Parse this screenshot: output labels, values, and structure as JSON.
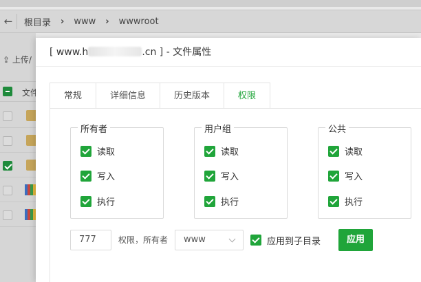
{
  "background": {
    "back_icon": "arrow-left-icon",
    "breadcrumbs": [
      "根目录",
      "www",
      "wwwroot"
    ],
    "upload_label": "上传/",
    "column_header": "文件"
  },
  "dialog": {
    "title_prefix": "[ www.h",
    "title_suffix": ".cn ] - 文件属性",
    "tabs": [
      {
        "label": "常规",
        "active": false
      },
      {
        "label": "详细信息",
        "active": false
      },
      {
        "label": "历史版本",
        "active": false
      },
      {
        "label": "权限",
        "active": true
      }
    ],
    "groups": [
      {
        "title": "所有者",
        "perms": [
          {
            "label": "读取",
            "checked": true
          },
          {
            "label": "写入",
            "checked": true
          },
          {
            "label": "执行",
            "checked": true
          }
        ]
      },
      {
        "title": "用户组",
        "perms": [
          {
            "label": "读取",
            "checked": true
          },
          {
            "label": "写入",
            "checked": true
          },
          {
            "label": "执行",
            "checked": true
          }
        ]
      },
      {
        "title": "公共",
        "perms": [
          {
            "label": "读取",
            "checked": true
          },
          {
            "label": "写入",
            "checked": true
          },
          {
            "label": "执行",
            "checked": true
          }
        ]
      }
    ],
    "permission_value": "777",
    "owner_label": "权限，所有者",
    "owner_select": "www",
    "apply_subdir_label": "应用到子目录",
    "apply_subdir_checked": true,
    "apply_button": "应用"
  },
  "colors": {
    "accent": "#20a53a"
  }
}
